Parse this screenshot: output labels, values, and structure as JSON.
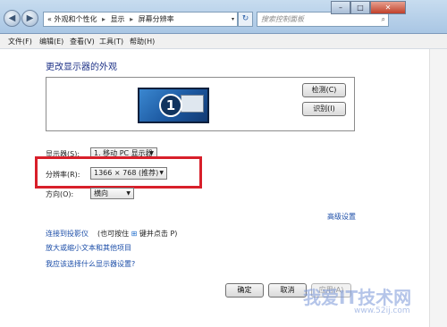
{
  "window": {
    "controls": {
      "minimize": "–",
      "maximize": "□",
      "close": "✕"
    }
  },
  "address_bar": {
    "prefix": "«",
    "crumbs": [
      "外观和个性化",
      "显示",
      "屏幕分辨率"
    ],
    "separator": "▸",
    "dropdown_icon": "▾",
    "refresh_icon": "↻"
  },
  "search": {
    "placeholder": "搜索控制面板",
    "icon": "search-icon"
  },
  "nav": {
    "back_icon": "◀",
    "forward_icon": "▶"
  },
  "menu": [
    "文件(F)",
    "编辑(E)",
    "查看(V)",
    "工具(T)",
    "帮助(H)"
  ],
  "main": {
    "title": "更改显示器的外观",
    "monitor_number": "1",
    "detect_button": "检测(C)",
    "identify_button": "识别(I)",
    "display_label": "显示器(S):",
    "display_value": "1. 移动 PC 显示器",
    "resolution_label": "分辨率(R):",
    "resolution_value": "1366 × 768 (推荐)",
    "orientation_label": "方向(O):",
    "orientation_value": "横向",
    "advanced_link": "高级设置",
    "projector_link": "连接到投影仪",
    "projector_hint_pre": "(也可按住",
    "projector_hint_post": "键并点击 P)",
    "textsize_link": "放大或缩小文本和其他项目",
    "help_link": "我应该选择什么显示器设置?",
    "ok_button": "确定",
    "cancel_button": "取消",
    "apply_button": "应用(A)"
  },
  "watermark": {
    "main": "我爱IT技术网",
    "sub": "www.52ij.com"
  },
  "colors": {
    "highlight_box": "#d81f2a",
    "link": "#1c4ea8",
    "title": "#1e3287"
  }
}
